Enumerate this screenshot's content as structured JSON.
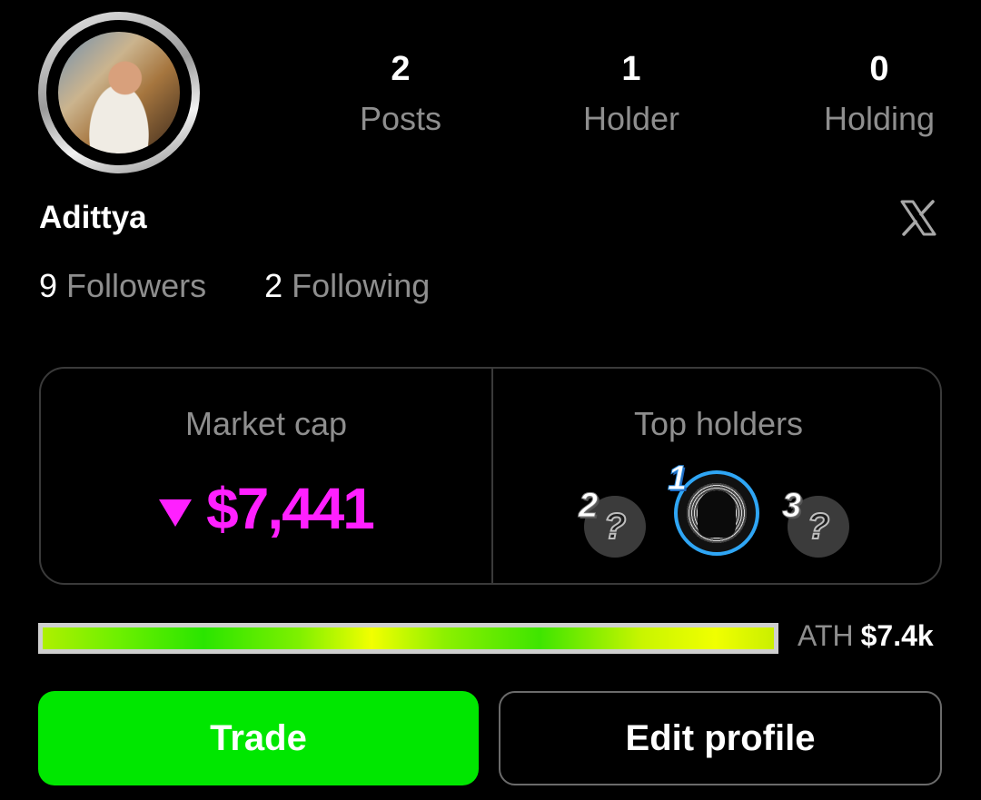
{
  "profile": {
    "name": "Adittya",
    "avatar_alt": "profile-photo"
  },
  "stats": [
    {
      "value": "2",
      "label": "Posts"
    },
    {
      "value": "1",
      "label": "Holder"
    },
    {
      "value": "0",
      "label": "Holding"
    }
  ],
  "social": {
    "followers_count": "9",
    "followers_label": "Followers",
    "following_count": "2",
    "following_label": "Following",
    "x_icon": "x-logo-icon"
  },
  "market": {
    "title": "Market cap",
    "value": "$7,441",
    "trend": "down",
    "trend_color": "#ff20ff"
  },
  "top_holders": {
    "title": "Top holders",
    "holders": [
      {
        "rank": "1",
        "known": true
      },
      {
        "rank": "2",
        "known": false,
        "placeholder": "?"
      },
      {
        "rank": "3",
        "known": false,
        "placeholder": "?"
      }
    ]
  },
  "ath": {
    "label": "ATH",
    "value": "$7.4k",
    "progress": 1.0
  },
  "actions": {
    "trade_label": "Trade",
    "edit_label": "Edit profile",
    "trade_color": "#00e700"
  }
}
